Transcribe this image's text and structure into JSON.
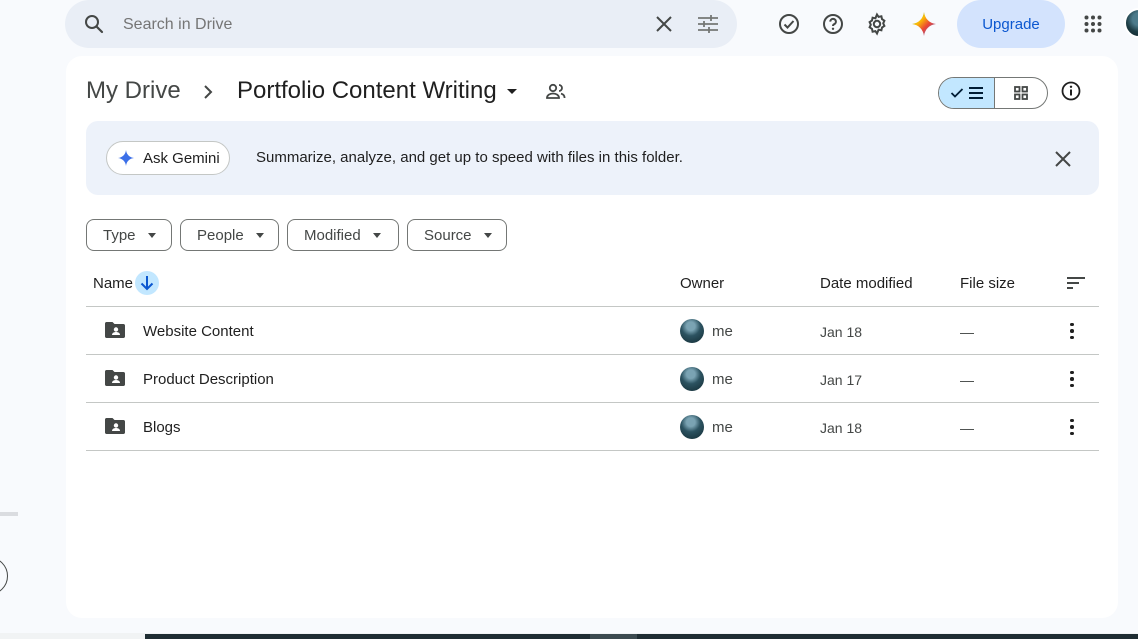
{
  "search": {
    "placeholder": "Search in Drive"
  },
  "header": {
    "upgrade_label": "Upgrade"
  },
  "breadcrumb": {
    "root": "My Drive",
    "current": "Portfolio Content Writing"
  },
  "gemini_banner": {
    "button_label": "Ask Gemini",
    "text": "Summarize, analyze, and get up to speed with files in this folder."
  },
  "filters": [
    {
      "label": "Type"
    },
    {
      "label": "People"
    },
    {
      "label": "Modified"
    },
    {
      "label": "Source"
    }
  ],
  "table": {
    "headers": {
      "name": "Name",
      "owner": "Owner",
      "date_modified": "Date modified",
      "file_size": "File size"
    },
    "rows": [
      {
        "name": "Website Content",
        "owner": "me",
        "date": "Jan 18",
        "size": "—"
      },
      {
        "name": "Product Description",
        "owner": "me",
        "date": "Jan 17",
        "size": "—"
      },
      {
        "name": "Blogs",
        "owner": "me",
        "date": "Jan 18",
        "size": "—"
      }
    ]
  },
  "colors": {
    "accent": "#0b57d0",
    "selected_bg": "#c2e7ff",
    "banner_bg": "#edf2fa",
    "page_bg": "#f8fafd"
  }
}
